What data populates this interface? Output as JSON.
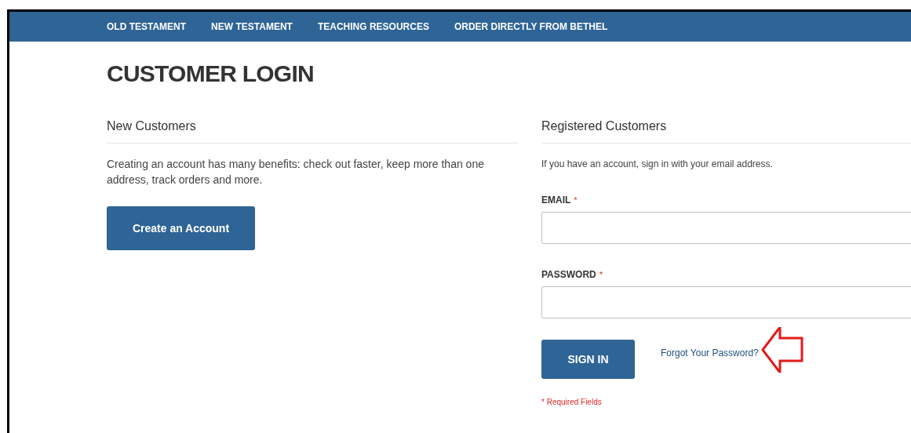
{
  "nav": [
    {
      "label": "OLD TESTAMENT"
    },
    {
      "label": "NEW TESTAMENT"
    },
    {
      "label": "TEACHING RESOURCES"
    },
    {
      "label": "ORDER DIRECTLY FROM BETHEL"
    }
  ],
  "title": "CUSTOMER LOGIN",
  "new_customers": {
    "heading": "New Customers",
    "text": "Creating an account has many benefits: check out faster, keep more than one address, track orders and more.",
    "button": "Create an Account"
  },
  "registered_customers": {
    "heading": "Registered Customers",
    "intro": "If you have an account, sign in with your email address.",
    "fields": [
      {
        "label": "EMAIL",
        "required_mark": "*"
      },
      {
        "label": "PASSWORD",
        "required_mark": "*"
      }
    ],
    "button": "SIGN IN",
    "forgot_link": "Forgot Your Password?",
    "required_note": "* Required Fields"
  }
}
